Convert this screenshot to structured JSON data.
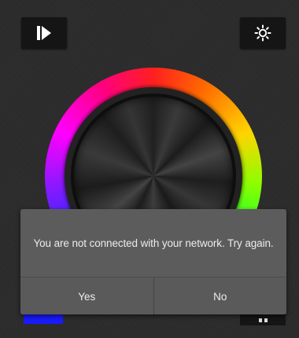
{
  "toolbar": {
    "play_icon": "play-step-icon",
    "settings_icon": "brightness-icon"
  },
  "color_wheel": {
    "knob_style": "brushed-metal"
  },
  "dialog": {
    "message": "You are not connected with your network. Try again.",
    "yes_label": "Yes",
    "no_label": "No"
  },
  "colors": {
    "background": "#2c2c2c",
    "dialog_background": "#5c5c5c",
    "dialog_text": "#ececec",
    "button_background": "#151515",
    "accent_blue": "#1a1aff"
  }
}
